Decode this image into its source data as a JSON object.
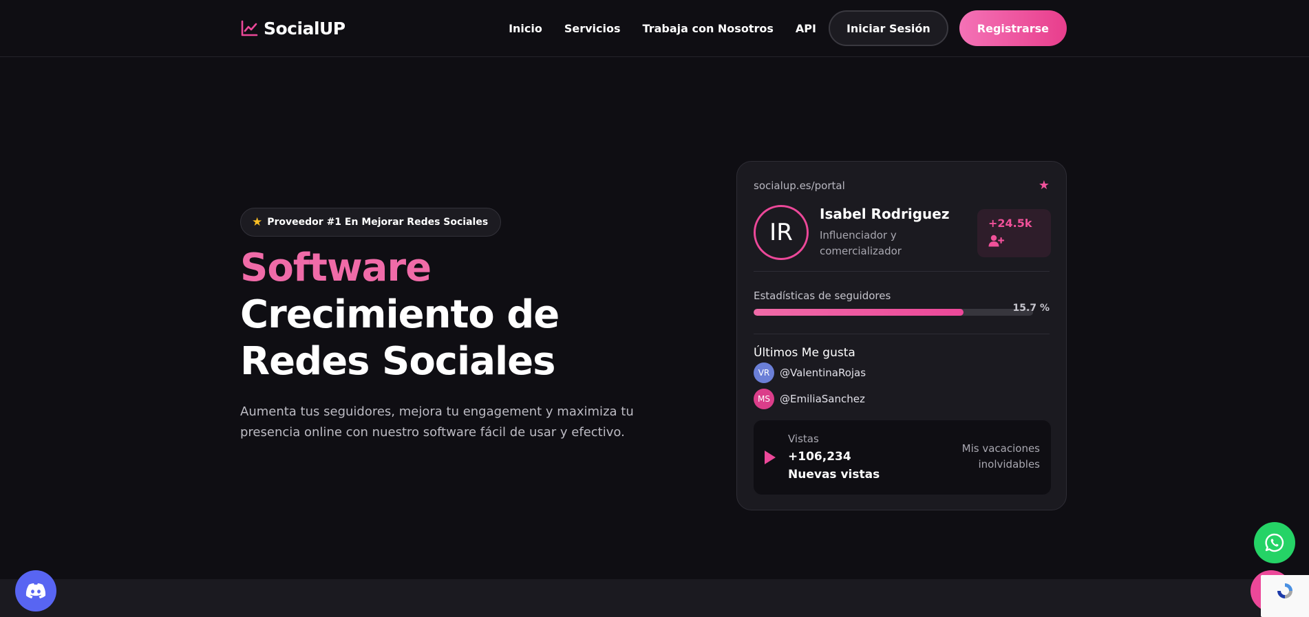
{
  "brand": {
    "name": "SocialUP",
    "accent": "#ec4899",
    "background": "#0f0e13"
  },
  "nav": {
    "links": [
      "Inicio",
      "Servicios",
      "Trabaja con Nosotros",
      "API"
    ],
    "login_label": "Iniciar Sesión",
    "register_label": "Registrarse"
  },
  "hero": {
    "badge": "Proveedor #1 En Mejorar Redes Sociales",
    "title_highlight": "Software",
    "title_line2": "Crecimiento de",
    "title_line3": "Redes Sociales",
    "subtitle": "Aumenta tus seguidores, mejora tu engagement y maximiza tu presencia online con nuestro software fácil de usar y efectivo."
  },
  "card": {
    "url": "socialup.es/portal",
    "profile": {
      "initials": "IR",
      "name": "Isabel Rodriguez",
      "role": "Influenciador y comercializador"
    },
    "followers_gain": "+24.5k",
    "followers_stats_label": "Estadísticas de seguidores",
    "followers_progress_label": "15.7 %",
    "followers_progress_fill": 0.75,
    "likes_title": "Últimos Me gusta",
    "likes": [
      {
        "initials": "VR",
        "handle": "@ValentinaRojas",
        "color": "#6b7fd7"
      },
      {
        "initials": "MS",
        "handle": "@EmiliaSanchez",
        "color": "#db3e8a"
      }
    ],
    "views": {
      "label": "Vistas",
      "value": "+106,234 Nuevas vistas",
      "caption": "Mis vacaciones inolvidables"
    }
  },
  "floating": {
    "discord_icon": "discord-icon",
    "whatsapp_icon": "whatsapp-icon",
    "chat_icon": "chat-bubble-icon"
  }
}
